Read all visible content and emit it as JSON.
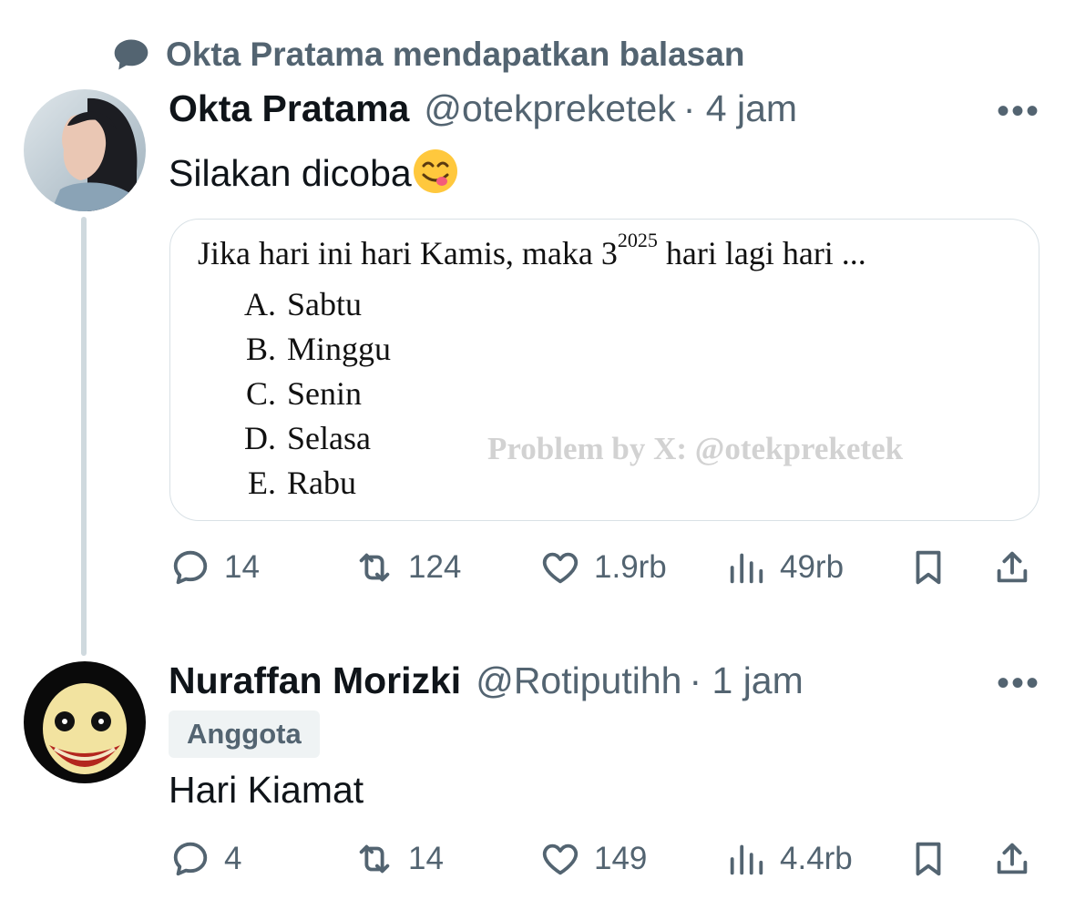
{
  "context": {
    "label": "Okta Pratama mendapatkan balasan",
    "icon": "speech-bubble-icon"
  },
  "tweet1": {
    "name": "Okta Pratama",
    "handle": "@otekpreketek",
    "time": "· 4 jam",
    "more": "•••",
    "text": "Silakan dicoba",
    "emoji": "😋",
    "media": {
      "question": "Jika hari ini hari Kamis, maka 3",
      "superscript": "2025",
      "question_end": " hari lagi hari ...",
      "options": [
        {
          "letter": "A.",
          "text": "Sabtu"
        },
        {
          "letter": "B.",
          "text": "Minggu"
        },
        {
          "letter": "C.",
          "text": "Senin"
        },
        {
          "letter": "D.",
          "text": "Selasa"
        },
        {
          "letter": "E.",
          "text": "Rabu"
        }
      ],
      "watermark": "Problem by X: @otekpreketek"
    },
    "stats": {
      "replies": "14",
      "retweets": "124",
      "likes": "1.9rb",
      "views": "49rb"
    }
  },
  "tweet2": {
    "name": "Nuraffan Morizki",
    "handle": "@Rotiputihh",
    "time": "· 1 jam",
    "more": "•••",
    "badge": "Anggota",
    "text": "Hari Kiamat",
    "stats": {
      "replies": "4",
      "retweets": "14",
      "likes": "149",
      "views": "4.4rb"
    }
  },
  "colors": {
    "text": "#0f1419",
    "secondary": "#536471",
    "line": "#cfd9de"
  }
}
